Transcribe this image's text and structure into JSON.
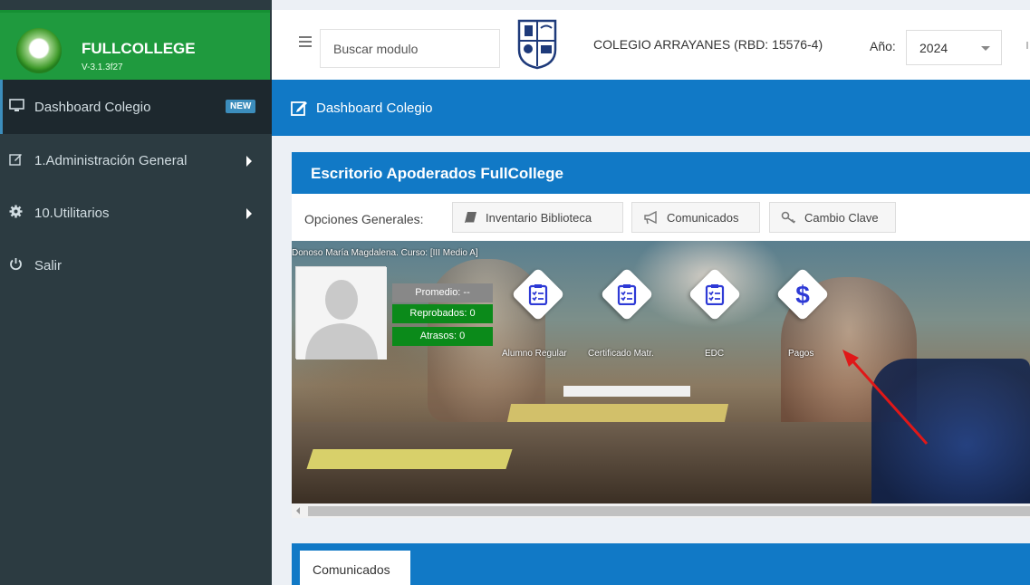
{
  "brand": {
    "name": "FULLCOLLEGE",
    "version": "V-3.1.3f27",
    "color": "#1f9a3e"
  },
  "sidebar": {
    "items": [
      {
        "label": "Dashboard Colegio",
        "icon": "monitor-icon",
        "badge": "NEW",
        "active": true
      },
      {
        "label": "1.Administración General",
        "icon": "edit-icon",
        "has_children": true
      },
      {
        "label": "10.Utilitarios",
        "icon": "gear-icon",
        "has_children": true
      },
      {
        "label": "Salir",
        "icon": "power-icon"
      }
    ]
  },
  "header": {
    "search_placeholder": "Buscar modulo",
    "school": "COLEGIO ARRAYANES (RBD: 15576-4)",
    "year_label": "Año:",
    "year_value": "2024"
  },
  "breadcrumb": {
    "label": "Dashboard Colegio",
    "icon": "edit-icon"
  },
  "panel": {
    "title": "Escritorio Apoderados FullCollege",
    "options_label": "Opciones Generales:",
    "options": [
      {
        "label": "Inventario Biblioteca",
        "icon": "book-icon"
      },
      {
        "label": "Comunicados",
        "icon": "megaphone-icon"
      },
      {
        "label": "Cambio Clave",
        "icon": "key-icon"
      }
    ]
  },
  "student": {
    "info": "Donoso María Magdalena. Curso: [III Medio A]",
    "stats": [
      "Promedio: --",
      "Reprobados: 0",
      "Atrasos: 0"
    ]
  },
  "tiles": [
    {
      "label": "Alumno Regular",
      "icon": "clipboard-check-icon"
    },
    {
      "label": "Certificado Matr.",
      "icon": "clipboard-check-icon"
    },
    {
      "label": "EDC",
      "icon": "clipboard-check-icon"
    },
    {
      "label": "Pagos",
      "icon": "dollar-icon"
    }
  ],
  "bottom": {
    "tab_label": "Comunicados"
  },
  "colors": {
    "accent_blue": "#1179c6",
    "sidebar_bg": "#2c3b41",
    "stat_green": "#0b8a1a",
    "tile_icon": "#2e3ad6"
  }
}
